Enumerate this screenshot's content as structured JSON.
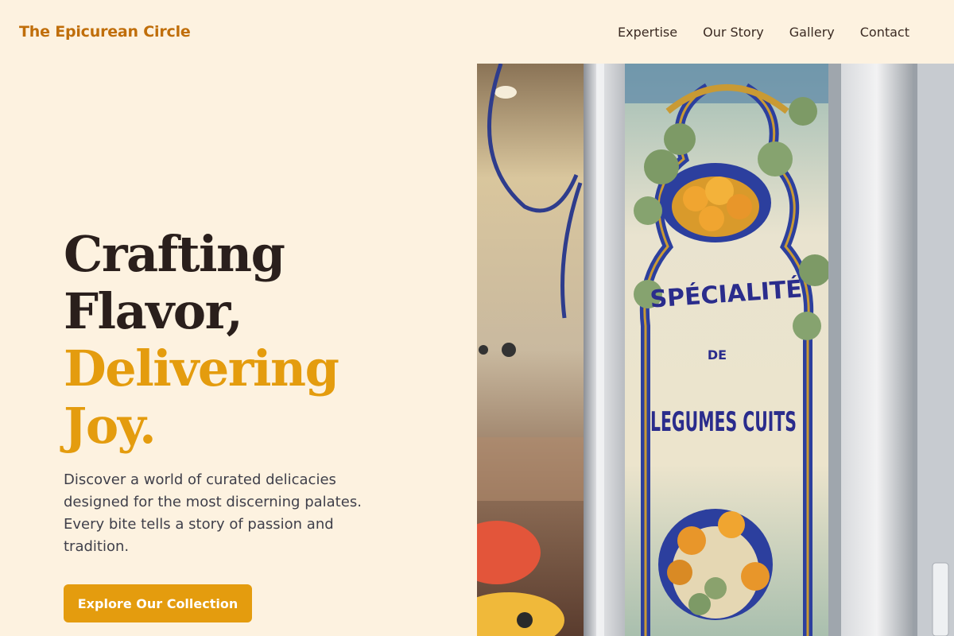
{
  "brand": {
    "name": "The Epicurean Circle",
    "accent_color": "#e49c0e",
    "logo_color": "#c06e0a",
    "background": "#fdf2e0"
  },
  "nav": {
    "items": [
      {
        "label": "Expertise"
      },
      {
        "label": "Our Story"
      },
      {
        "label": "Gallery"
      },
      {
        "label": "Contact"
      }
    ]
  },
  "hero": {
    "headline_line1": "Crafting",
    "headline_line2": "Flavor,",
    "headline_accent_line1": "Delivering",
    "headline_accent_line2": "Joy.",
    "description": "Discover a world of curated delicacies designed for the most discerning palates. Every bite tells a story of passion and tradition.",
    "cta_label": "Explore Our Collection",
    "image": {
      "sign_line1": "SPÉCIALITÉ",
      "sign_line2": "DE",
      "sign_line3": "LEGUMES CUITS"
    }
  }
}
